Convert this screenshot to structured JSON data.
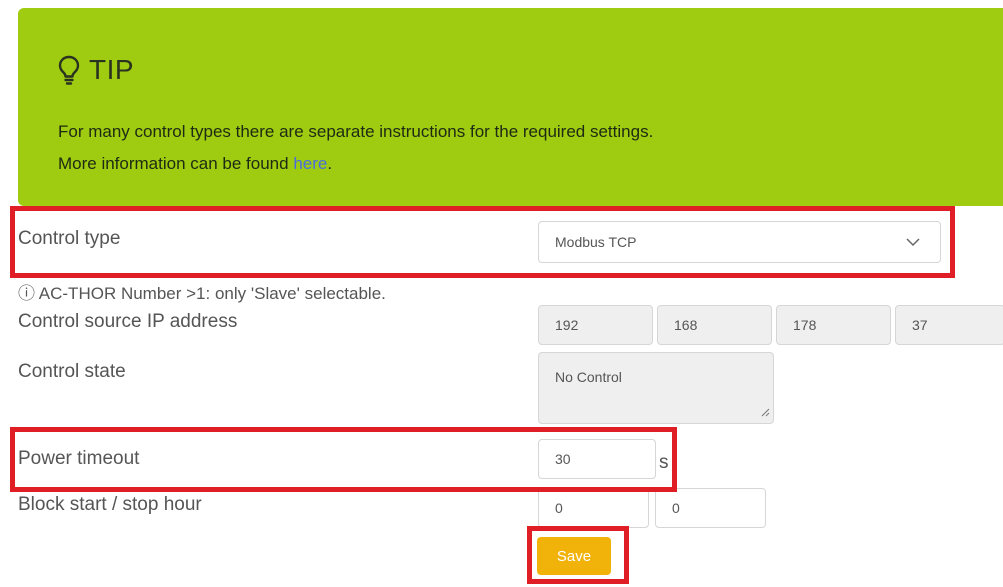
{
  "tip": {
    "title": "TIP",
    "line1": "For many control types there are separate instructions for the required settings.",
    "line2_prefix": "More information can be found ",
    "link_text": "here",
    "line2_suffix": ".",
    "icon": "lightbulb-icon",
    "background_color": "#9fcb10",
    "link_color": "#4a6ee0"
  },
  "control_type": {
    "label": "Control type",
    "selected": "Modbus TCP",
    "icon": "chevron-down-icon"
  },
  "hint": "ⓘ AC-THOR Number >1: only 'Slave' selectable.",
  "control_source_ip": {
    "label": "Control source IP address",
    "octets": [
      "192",
      "168",
      "178",
      "37"
    ]
  },
  "control_state": {
    "label": "Control state",
    "value": "No Control"
  },
  "power_timeout": {
    "label": "Power timeout",
    "value": "30",
    "unit": "s"
  },
  "block_hours": {
    "label": "Block start / stop hour",
    "start": "0",
    "stop": "0"
  },
  "save_label": "Save",
  "colors": {
    "highlight": "#e01e25",
    "save_button": "#f1b20a",
    "disabled_field": "#efefef"
  }
}
